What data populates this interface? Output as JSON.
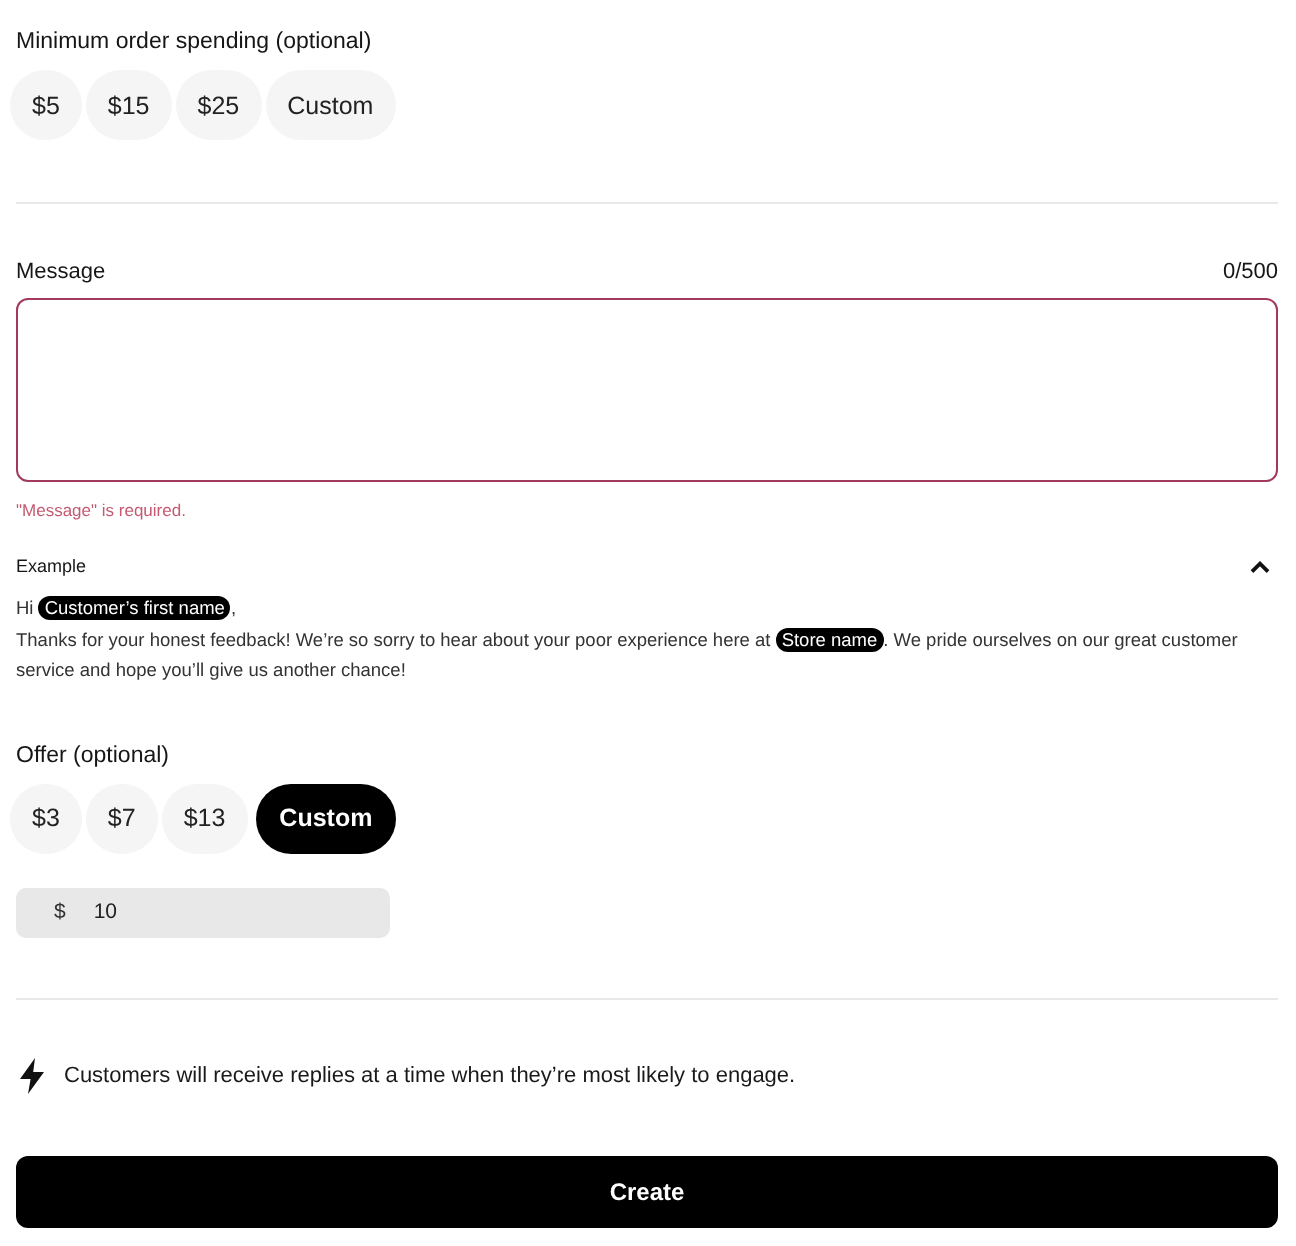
{
  "min_order": {
    "label": "Minimum order spending (optional)",
    "options": [
      {
        "label": "$5",
        "selected": false
      },
      {
        "label": "$15",
        "selected": false
      },
      {
        "label": "$25",
        "selected": false
      },
      {
        "label": "Custom",
        "selected": false
      }
    ]
  },
  "message": {
    "label": "Message",
    "counter": "0/500",
    "invalid": true,
    "error": "\"Message\" is required."
  },
  "example": {
    "title": "Example",
    "expanded": true,
    "paragraphs": [
      [
        {
          "kind": "text",
          "text": "Hi "
        },
        {
          "kind": "tag",
          "text": "Customer’s first name"
        },
        {
          "kind": "text",
          "text": ","
        }
      ],
      [
        {
          "kind": "text",
          "text": "Thanks for your honest feedback! We’re so sorry to hear about your poor experience here at "
        },
        {
          "kind": "tag",
          "text": "Store name"
        },
        {
          "kind": "text",
          "text": ". We pride ourselves on our great customer service and hope you’ll give us another chance!"
        }
      ]
    ]
  },
  "offer": {
    "label": "Offer (optional)",
    "options": [
      {
        "label": "$3",
        "selected": false
      },
      {
        "label": "$7",
        "selected": false
      },
      {
        "label": "$13",
        "selected": false
      },
      {
        "label": "Custom",
        "selected": true
      }
    ],
    "amount": {
      "prefix": "$",
      "value": "10"
    }
  },
  "notice": {
    "text": "Customers will receive replies at a time when they’re most likely to engage."
  },
  "submit": {
    "label": "Create"
  }
}
